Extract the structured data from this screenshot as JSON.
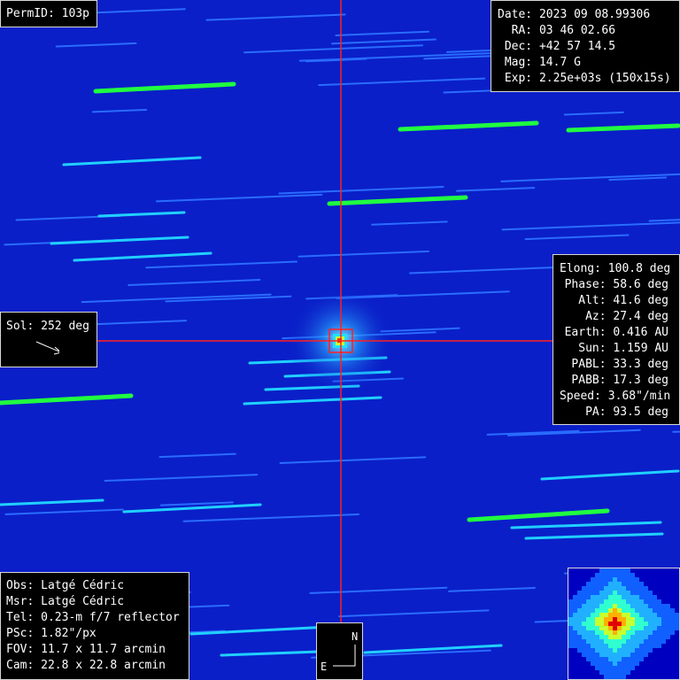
{
  "perm": {
    "text": "PermID: 103p"
  },
  "info": {
    "lines": [
      "Date: 2023 09 08.99306",
      "  RA: 03 46 02.66",
      " Dec: +42 57 14.5",
      " Mag: 14.7 G",
      " Exp: 2.25e+03s (150x15s)"
    ]
  },
  "geometry": {
    "lines": [
      "Elong: 100.8 deg",
      "Phase: 58.6 deg",
      "Alt: 41.6 deg",
      "Az: 27.4 deg",
      "Earth: 0.416 AU",
      "Sun: 1.159 AU",
      "PABL: 33.3 deg",
      "PABB: 17.3 deg",
      "Speed: 3.68\"/min",
      "PA: 93.5 deg"
    ]
  },
  "sol": {
    "text": "Sol: 252 deg"
  },
  "observer": {
    "lines": [
      "Obs: Latgé Cédric",
      "Msr: Latgé Cédric",
      "Tel: 0.23-m f/7 reflector",
      "PSc: 1.82\"/px",
      "FOV: 11.7 x 11.7 arcmin",
      "Cam: 22.8 x 22.8 arcmin"
    ]
  },
  "compass": {
    "north": "N",
    "east": "E"
  },
  "colors": {
    "sky": "#0a1fc8",
    "crosshair": "#ff2020",
    "trail_bright": "#20ff40",
    "trail_mid": "#20d0ff",
    "trail_faint": "#2a6cff"
  }
}
